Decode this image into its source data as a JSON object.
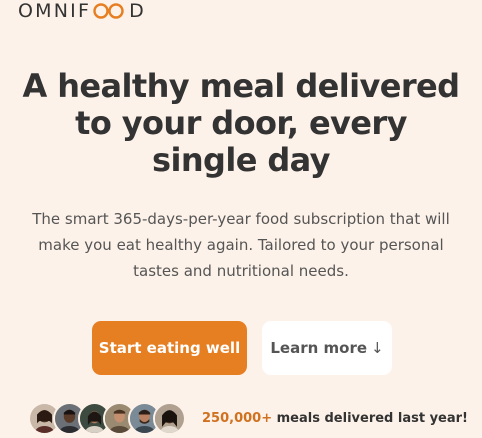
{
  "brand": {
    "name_start": "OMNIF",
    "name_end": "D",
    "logo_icon": "infinity-oo-icon",
    "accent_color": "#e67e22"
  },
  "hero": {
    "title": "A healthy meal delivered to your door, every single day",
    "description": "The smart 365-days-per-year food subscription that will make you eat healthy again. Tailored to your personal tastes and nutritional needs."
  },
  "buttons": {
    "primary_label": "Start eating well",
    "secondary_label": "Learn more",
    "secondary_arrow": "↓"
  },
  "delivered": {
    "count": "250,000+",
    "text": "meals delivered last year!",
    "avatars": [
      {
        "name": "customer-avatar-1"
      },
      {
        "name": "customer-avatar-2"
      },
      {
        "name": "customer-avatar-3"
      },
      {
        "name": "customer-avatar-4"
      },
      {
        "name": "customer-avatar-5"
      },
      {
        "name": "customer-avatar-6"
      }
    ]
  },
  "colors": {
    "background": "#fdf2e9",
    "primary": "#e67e22",
    "text_dark": "#333333",
    "text_muted": "#555555",
    "count_color": "#cf711f"
  }
}
